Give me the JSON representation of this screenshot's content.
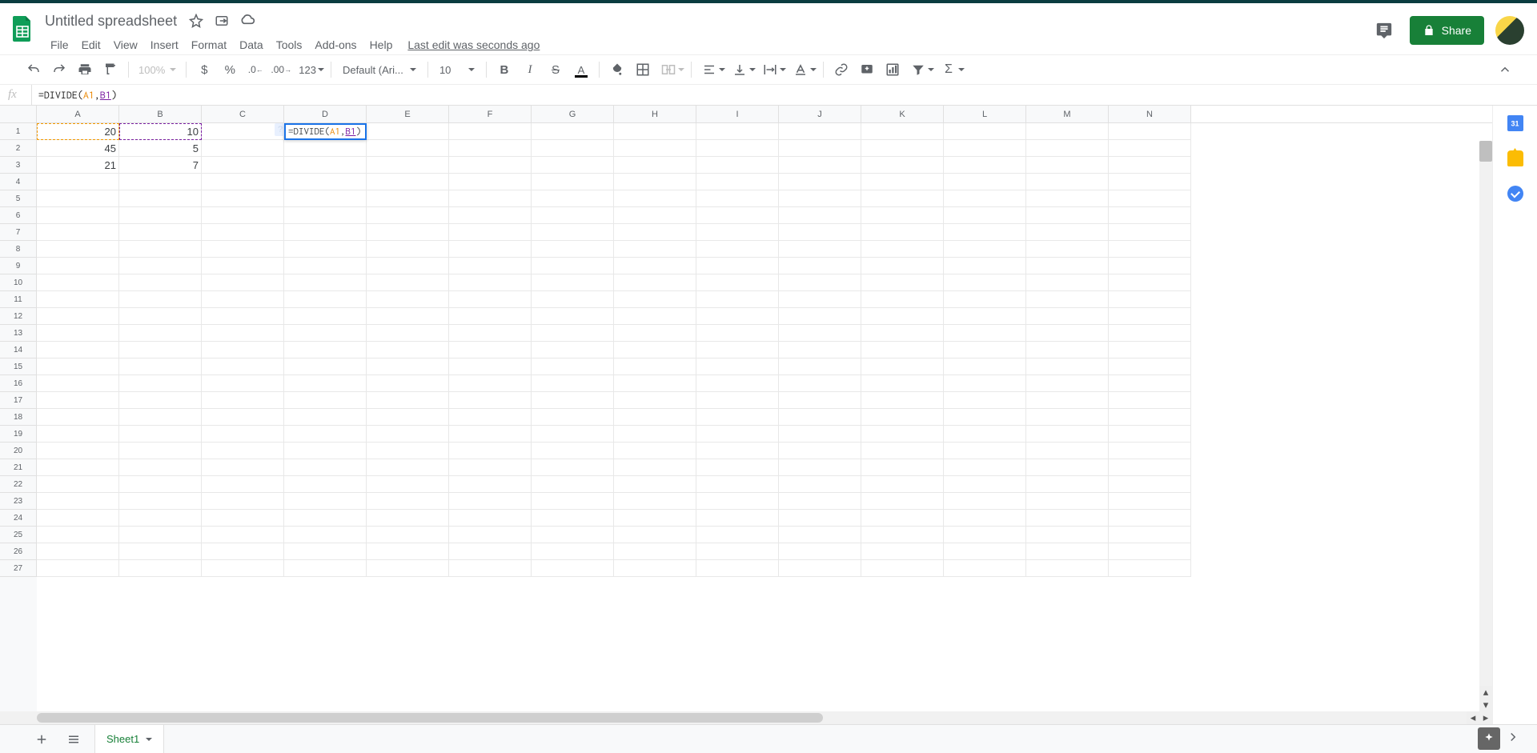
{
  "doc": {
    "title": "Untitled spreadsheet",
    "last_edit": "Last edit was seconds ago"
  },
  "menus": [
    "File",
    "Edit",
    "View",
    "Insert",
    "Format",
    "Data",
    "Tools",
    "Add-ons",
    "Help"
  ],
  "toolbar": {
    "zoom": "100%",
    "font": "Default (Ari...",
    "font_size": "10",
    "number_fmt": "123"
  },
  "share_label": "Share",
  "formula_bar": {
    "prefix": "=DIVIDE(",
    "ref1": "A1",
    "comma": ",",
    "ref2": "B1",
    "suffix": ")"
  },
  "columns": [
    "A",
    "B",
    "C",
    "D",
    "E",
    "F",
    "G",
    "H",
    "I",
    "J",
    "K",
    "L",
    "M",
    "N"
  ],
  "row_count": 27,
  "cells": {
    "A1": "20",
    "B1": "10",
    "A2": "45",
    "B2": "5",
    "A3": "21",
    "B3": "7"
  },
  "active_cell_formula": {
    "prefix": "=DIVIDE(",
    "ref1": "A1",
    "comma": ",",
    "ref2": "B1",
    "suffix": ")"
  },
  "sheet_tab": "Sheet1",
  "hint_marker": "?"
}
